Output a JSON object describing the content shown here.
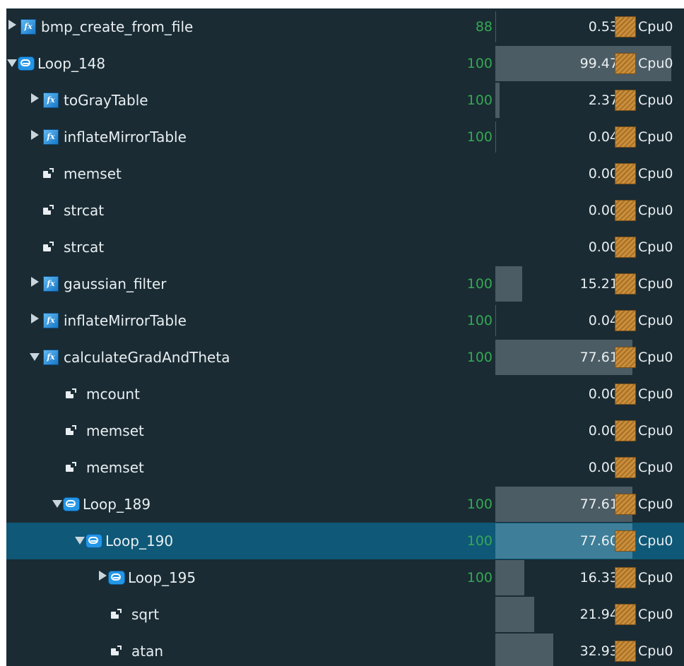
{
  "tree": {
    "rows": [
      {
        "label": "bmp_create_from_file",
        "type": "function",
        "toggle": "collapsed",
        "depth": 0,
        "percent": "88",
        "value": "0.53",
        "value_fraction": 0.0053,
        "cpu": "Cpu0",
        "selected": false
      },
      {
        "label": "Loop_148",
        "type": "loop",
        "toggle": "expanded",
        "depth": 0,
        "percent": "100",
        "value": "99.47",
        "value_fraction": 0.9947,
        "cpu": "Cpu0",
        "selected": false
      },
      {
        "label": "toGrayTable",
        "type": "function",
        "toggle": "collapsed",
        "depth": 1,
        "percent": "100",
        "value": "2.37",
        "value_fraction": 0.0237,
        "cpu": "Cpu0",
        "selected": false
      },
      {
        "label": "inflateMirrorTable",
        "type": "function",
        "toggle": "collapsed",
        "depth": 1,
        "percent": "100",
        "value": "0.04",
        "value_fraction": 0.0004,
        "cpu": "Cpu0",
        "selected": false
      },
      {
        "label": "memset",
        "type": "call",
        "toggle": "none",
        "depth": 1,
        "percent": "",
        "value": "0.00",
        "value_fraction": 0,
        "cpu": "Cpu0",
        "selected": false
      },
      {
        "label": "strcat",
        "type": "call",
        "toggle": "none",
        "depth": 1,
        "percent": "",
        "value": "0.00",
        "value_fraction": 0,
        "cpu": "Cpu0",
        "selected": false
      },
      {
        "label": "strcat",
        "type": "call",
        "toggle": "none",
        "depth": 1,
        "percent": "",
        "value": "0.00",
        "value_fraction": 0,
        "cpu": "Cpu0",
        "selected": false
      },
      {
        "label": "gaussian_filter",
        "type": "function",
        "toggle": "collapsed",
        "depth": 1,
        "percent": "100",
        "value": "15.21",
        "value_fraction": 0.1521,
        "cpu": "Cpu0",
        "selected": false
      },
      {
        "label": "inflateMirrorTable",
        "type": "function",
        "toggle": "collapsed",
        "depth": 1,
        "percent": "100",
        "value": "0.04",
        "value_fraction": 0.0004,
        "cpu": "Cpu0",
        "selected": false
      },
      {
        "label": "calculateGradAndTheta",
        "type": "function",
        "toggle": "expanded",
        "depth": 1,
        "percent": "100",
        "value": "77.61",
        "value_fraction": 0.7761,
        "cpu": "Cpu0",
        "selected": false
      },
      {
        "label": "mcount",
        "type": "call",
        "toggle": "none",
        "depth": 2,
        "percent": "",
        "value": "0.00",
        "value_fraction": 0,
        "cpu": "Cpu0",
        "selected": false
      },
      {
        "label": "memset",
        "type": "call",
        "toggle": "none",
        "depth": 2,
        "percent": "",
        "value": "0.00",
        "value_fraction": 0,
        "cpu": "Cpu0",
        "selected": false
      },
      {
        "label": "memset",
        "type": "call",
        "toggle": "none",
        "depth": 2,
        "percent": "",
        "value": "0.00",
        "value_fraction": 0,
        "cpu": "Cpu0",
        "selected": false
      },
      {
        "label": "Loop_189",
        "type": "loop",
        "toggle": "expanded",
        "depth": 2,
        "percent": "100",
        "value": "77.61",
        "value_fraction": 0.7761,
        "cpu": "Cpu0",
        "selected": false
      },
      {
        "label": "Loop_190",
        "type": "loop",
        "toggle": "expanded",
        "depth": 3,
        "percent": "100",
        "value": "77.60",
        "value_fraction": 0.776,
        "cpu": "Cpu0",
        "selected": true
      },
      {
        "label": "Loop_195",
        "type": "loop",
        "toggle": "collapsed",
        "depth": 4,
        "percent": "100",
        "value": "16.33",
        "value_fraction": 0.1633,
        "cpu": "Cpu0",
        "selected": false
      },
      {
        "label": "sqrt",
        "type": "call",
        "toggle": "none",
        "depth": 4,
        "percent": "",
        "value": "21.94",
        "value_fraction": 0.2194,
        "cpu": "Cpu0",
        "selected": false
      },
      {
        "label": "atan",
        "type": "call",
        "toggle": "none",
        "depth": 4,
        "percent": "",
        "value": "32.93",
        "value_fraction": 0.3293,
        "cpu": "Cpu0",
        "selected": false
      }
    ]
  },
  "colors": {
    "background": "#1a2b33",
    "selected_row": "#0f5877",
    "bar": "#4c5c64",
    "percent_text": "#34a853",
    "text": "#e9eff2"
  },
  "icons": {
    "function": "function-fx-icon",
    "loop": "loop-icon",
    "call": "external-call-icon",
    "cpu": "cpu-icon"
  }
}
